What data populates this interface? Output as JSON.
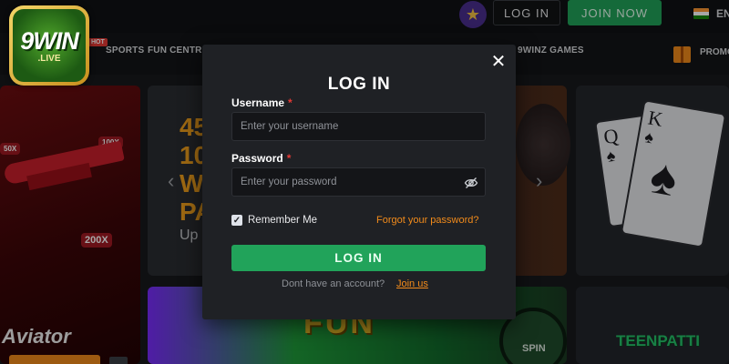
{
  "header": {
    "login_label": "LOG IN",
    "join_label": "JOIN NOW",
    "language": "EN"
  },
  "logo": {
    "main": "9WIN",
    "sub": ".LIVE"
  },
  "nav": {
    "items": [
      "SPORTS",
      "FUN CENTRAL",
      "9WINZ GAMES",
      "PROMO"
    ],
    "hot_badge": "HOT"
  },
  "tiles": {
    "aviator": {
      "title": "Aviator",
      "multipliers": [
        "50X",
        "100X",
        "200X"
      ]
    },
    "promo": {
      "headline_lines": [
        "45",
        "10",
        "W",
        "PA"
      ],
      "subline": "Up"
    },
    "fun_central": {
      "title": "FUN",
      "spin": "SPIN"
    },
    "teen_patti": {
      "title": "TEENPATTI"
    }
  },
  "modal": {
    "title": "LOG IN",
    "username_label": "Username",
    "username_placeholder": "Enter your username",
    "password_label": "Password",
    "password_placeholder": "Enter your password",
    "required_mark": "*",
    "remember_label": "Remember Me",
    "remember_checked": true,
    "forgot_link": "Forgot your password?",
    "submit_label": "LOG IN",
    "no_account_text": "Dont have an account?",
    "join_link": "Join us"
  },
  "colors": {
    "accent_green": "#21a35a",
    "accent_orange": "#f28b1b",
    "required_red": "#e53935",
    "modal_bg": "#1f2125"
  },
  "icons": {
    "close": "close-icon",
    "password_toggle": "eye-off-icon",
    "star": "star-icon",
    "promo": "gift-icon",
    "flag": "india-flag-icon"
  }
}
